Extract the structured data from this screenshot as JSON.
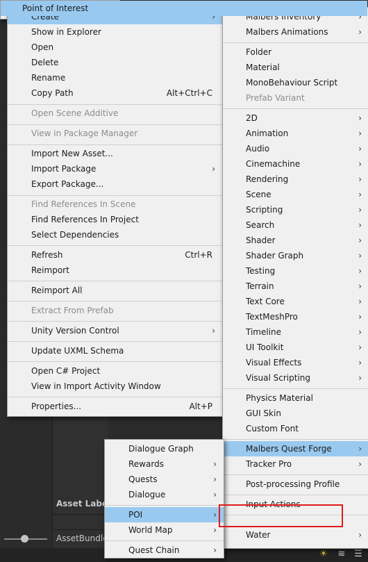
{
  "main_menu": {
    "create": "Create",
    "show_in_explorer": "Show in Explorer",
    "open": "Open",
    "delete": "Delete",
    "rename": "Rename",
    "copy_path": "Copy Path",
    "copy_path_shortcut": "Alt+Ctrl+C",
    "open_scene_additive": "Open Scene Additive",
    "view_in_package_manager": "View in Package Manager",
    "import_new_asset": "Import New Asset...",
    "import_package": "Import Package",
    "export_package": "Export Package...",
    "find_references_in_scene": "Find References In Scene",
    "find_references_in_project": "Find References In Project",
    "select_dependencies": "Select Dependencies",
    "refresh": "Refresh",
    "refresh_shortcut": "Ctrl+R",
    "reimport": "Reimport",
    "reimport_all": "Reimport All",
    "extract_from_prefab": "Extract From Prefab",
    "unity_version_control": "Unity Version Control",
    "update_uxml_schema": "Update UXML Schema",
    "open_csharp_project": "Open C# Project",
    "view_in_import_activity": "View in Import Activity Window",
    "properties": "Properties...",
    "properties_shortcut": "Alt+P"
  },
  "create_menu": {
    "malbers_inventory": "Malbers Inventory",
    "malbers_animations": "Malbers Animations",
    "folder": "Folder",
    "material": "Material",
    "monobehaviour_script": "MonoBehaviour Script",
    "prefab_variant": "Prefab Variant",
    "2d": "2D",
    "animation": "Animation",
    "audio": "Audio",
    "cinemachine": "Cinemachine",
    "rendering": "Rendering",
    "scene": "Scene",
    "scripting": "Scripting",
    "search": "Search",
    "shader": "Shader",
    "shader_graph": "Shader Graph",
    "testing": "Testing",
    "terrain": "Terrain",
    "text_core": "Text Core",
    "textmeshpro": "TextMeshPro",
    "timeline": "Timeline",
    "ui_toolkit": "UI Toolkit",
    "visual_effects": "Visual Effects",
    "visual_scripting": "Visual Scripting",
    "physics_material": "Physics Material",
    "gui_skin": "GUI Skin",
    "custom_font": "Custom Font",
    "malbers_quest_forge": "Malbers Quest Forge",
    "tracker_pro": "Tracker Pro",
    "post_processing_profile": "Post-processing Profile",
    "input_actions": "Input Actions",
    "water": "Water"
  },
  "quest_menu": {
    "dialogue_graph": "Dialogue Graph",
    "rewards": "Rewards",
    "quests": "Quests",
    "dialogue": "Dialogue",
    "poi": "POI",
    "world_map": "World Map",
    "quest_chain": "Quest Chain"
  },
  "poi_menu": {
    "point_of_interest": "Point of Interest"
  },
  "background": {
    "asset_labels": "Asset Labels",
    "asset_bundle": "AssetBundle"
  },
  "icons": {
    "submenu_arrow": "›",
    "bug_icon": "☀",
    "layers_icon": "≋"
  },
  "colors": {
    "highlight": "#99c9ef",
    "menu_bg": "#f0f0f0",
    "callout_red": "#e01b1b"
  }
}
